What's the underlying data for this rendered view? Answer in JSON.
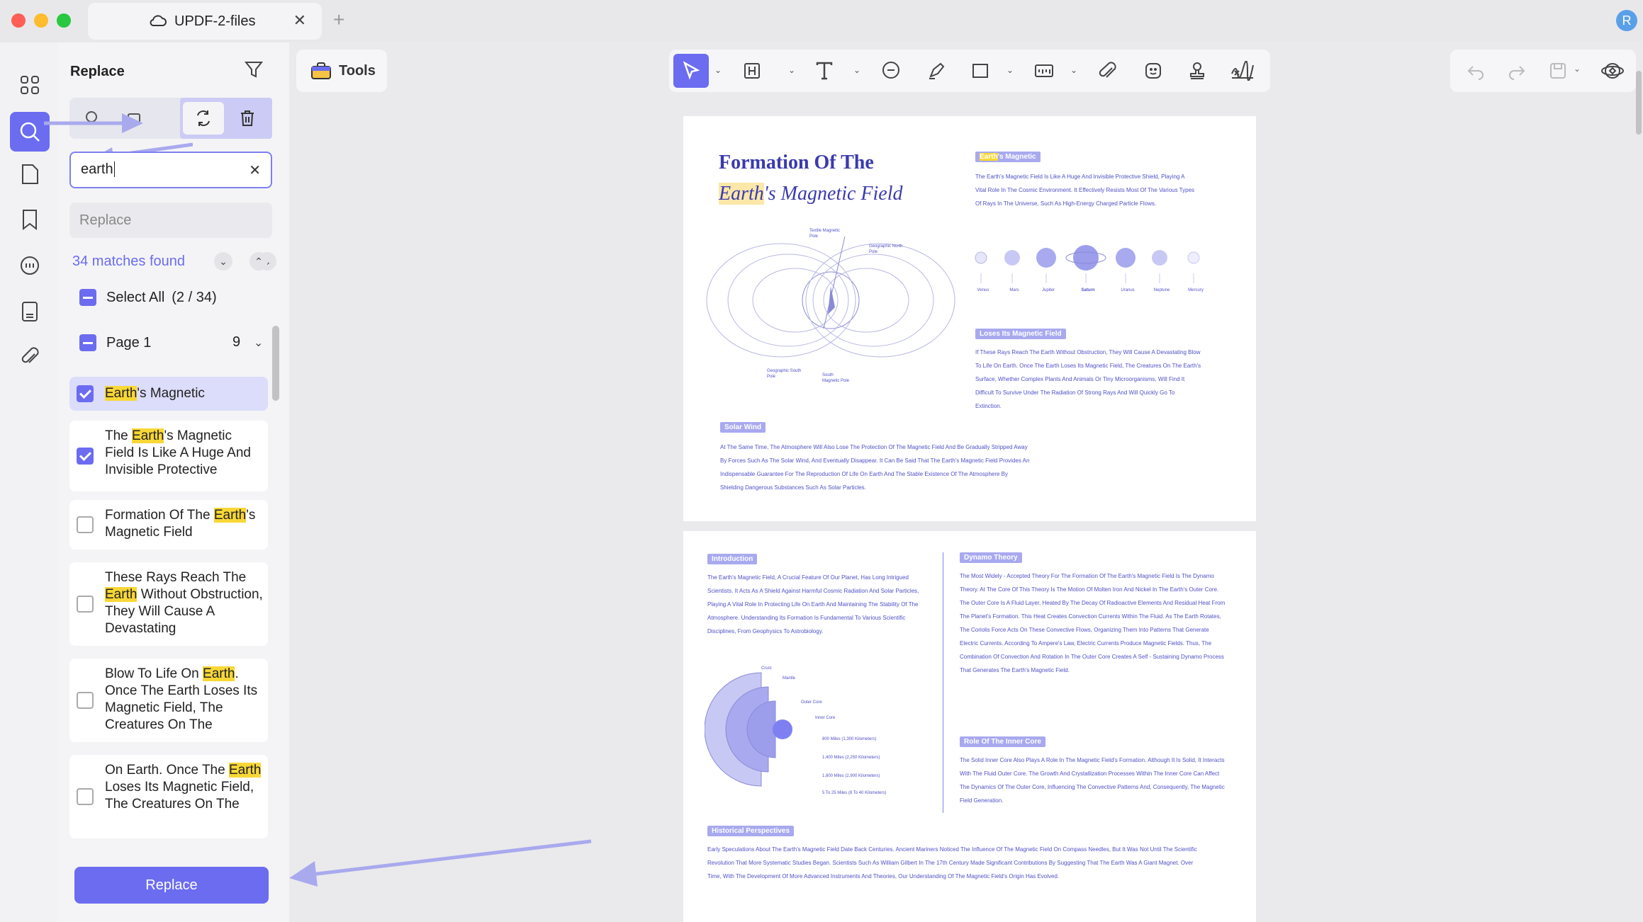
{
  "window": {
    "tab_title": "UPDF-2-files",
    "new_tab": "+",
    "close_tab": "✕",
    "avatar_letter": "R",
    "traffic_colors": [
      "#ff5f57",
      "#febc2e",
      "#28c840"
    ]
  },
  "sidebar_icons": [
    "grid-icon",
    "search-icon",
    "page-icon",
    "bookmark-icon",
    "comment-icon",
    "stamp-list-icon",
    "attachment-icon"
  ],
  "panel": {
    "title": "Replace",
    "search_value": "earth",
    "replace_placeholder": "Replace",
    "matches_text": "34 matches found",
    "select_all": "Select All",
    "select_count": "(2 / 34)",
    "page_label": "Page 1",
    "page_count": "9",
    "replace_button": "Replace"
  },
  "results": [
    {
      "pre": "",
      "hit": "Earth",
      "post": "'s Magnetic",
      "checked": true
    },
    {
      "pre": "The ",
      "hit": "Earth",
      "post": "'s Magnetic Field Is Like A Huge And Invisible Protective",
      "checked": true
    },
    {
      "pre": "Formation Of The ",
      "hit": "Earth",
      "post": "'s Magnetic Field",
      "checked": false
    },
    {
      "pre": "These Rays Reach The ",
      "hit": "Earth",
      "post": " Without Obstruction, They Will Cause A Devastating",
      "checked": false
    },
    {
      "pre": "Blow To Life On ",
      "hit": "Earth",
      "post": ". Once The Earth Loses Its Magnetic Field, The Creatures On The",
      "checked": false
    },
    {
      "pre": "On Earth. Once The ",
      "hit": "Earth",
      "post": " Loses Its Magnetic Field, The Creatures On The",
      "checked": false
    }
  ],
  "toolbar": {
    "tools_label": "Tools"
  },
  "pdf": {
    "title_line1": "Formation Of The",
    "title_earth": "Earth",
    "title_line2_rest": "'s Magnetic Field",
    "h_magnetic_hit": "Earth",
    "h_magnetic": "'s Magnetic",
    "magnetic_text": "The Earth's Magnetic Field Is Like A Huge And Invisible Protective Shield, Playing A Vital Role In The Cosmic Environment. It Effectively Resists Most Of The Various Types Of Rays In The Universe, Such As High-Energy Charged Particle Flows.",
    "planets": [
      "Venus",
      "Mars",
      "Jupiter",
      "Saturn",
      "Uranus",
      "Neptune",
      "Mercury"
    ],
    "h_loses": "Loses Its Magnetic Field",
    "loses_text": "If These Rays Reach The Earth Without Obstruction, They Will Cause A Devastating Blow To Life On Earth. Once The Earth Loses Its Magnetic Field, The Creatures On The Earth's Surface, Whether Complex Plants And Animals Or Tiny Microorganisms, Will Find It Difficult To Survive Under The Radiation Of Strong Rays And Will Quickly Go To Extinction.",
    "h_solar": "Solar Wind",
    "solar_text": "At The Same Time, The Atmosphere Will Also Lose The Protection Of The Magnetic Field And Be Gradually Stripped Away By Forces Such As The Solar Wind, And Eventually Disappear. It Can Be Said That The Earth's Magnetic Field Provides An Indispensable Guarantee For The Reproduction Of Life On Earth And The Stable Existence Of The Atmosphere By Shielding Dangerous Substances Such As Solar Particles.",
    "fig_labels": [
      "Textile Magnetic Pole",
      "Geographic North Pole",
      "Geographic South Pole",
      "South Magnetic Pole"
    ],
    "h_intro": "Introduction",
    "intro_text": "The Earth's Magnetic Field, A Crucial Feature Of Our Planet, Has Long Intrigued Scientists. It Acts As A Shield Against Harmful Cosmic Radiation And Solar Particles, Playing A Vital Role In Protecting Life On Earth And Maintaining The Stability Of The Atmosphere. Understanding Its Formation Is Fundamental To Various Scientific Disciplines, From Geophysics To Astrobiology.",
    "h_dynamo": "Dynamo Theory",
    "dynamo_text": "The Most Widely - Accepted Theory For The Formation Of The Earth's Magnetic Field Is The Dynamo Theory. At The Core Of This Theory Is The Motion Of Molten Iron And Nickel In The Earth's Outer Core. The Outer Core Is A Fluid Layer, Heated By The Decay Of Radioactive Elements And Residual Heat From The Planet's Formation. This Heat Creates Convection Currents Within The Fluid. As The Earth Rotates, The Coriolis Force Acts On These Convective Flows, Organizing Them Into Patterns That Generate Electric Currents. According To Ampere's Law, Electric Currents Produce Magnetic Fields. Thus, The Combination Of Convection And Rotation In The Outer Core Creates A Self - Sustaining Dynamo Process That Generates The Earth's Magnetic Field.",
    "h_inner": "Role Of The Inner Core",
    "inner_text": "The Solid Inner Core Also Plays A Role In The Magnetic Field's Formation. Although It Is Solid, It Interacts With The Fluid Outer Core. The Growth And Crystallization Processes Within The Inner Core Can Affect The Dynamics Of The Outer Core, Influencing The Convective Patterns And, Consequently, The Magnetic Field Generation.",
    "core_labels": [
      "Crust",
      "Mantle",
      "Outer Core",
      "Inner Core",
      "800 Miles (1,300 Kilometers)",
      "1,400 Miles (2,250 Kilometers)",
      "1,800 Miles (2,900 Kilometers)",
      "5 To 25 Miles (8 To 40 Kilometers)"
    ],
    "h_hist": "Historical Perspectives",
    "hist_text": "Early Speculations About The Earth's Magnetic Field Date Back Centuries. Ancient Mariners Noticed The Influence Of The Magnetic Field On Compass Needles, But It Was Not Until The Scientific Revolution That More Systematic Studies Began. Scientists Such As William Gilbert In The 17th Century Made Significant Contributions By Suggesting That The Earth Was A Giant Magnet. Over Time, With The Development Of More Advanced Instruments And Theories, Our Understanding Of The Magnetic Field's Origin Has Evolved."
  },
  "colors": {
    "accent": "#6b6cf0",
    "highlight": "#f8d736",
    "pdf_heading": "#3a3ab0",
    "pdf_text": "#5050c8"
  }
}
